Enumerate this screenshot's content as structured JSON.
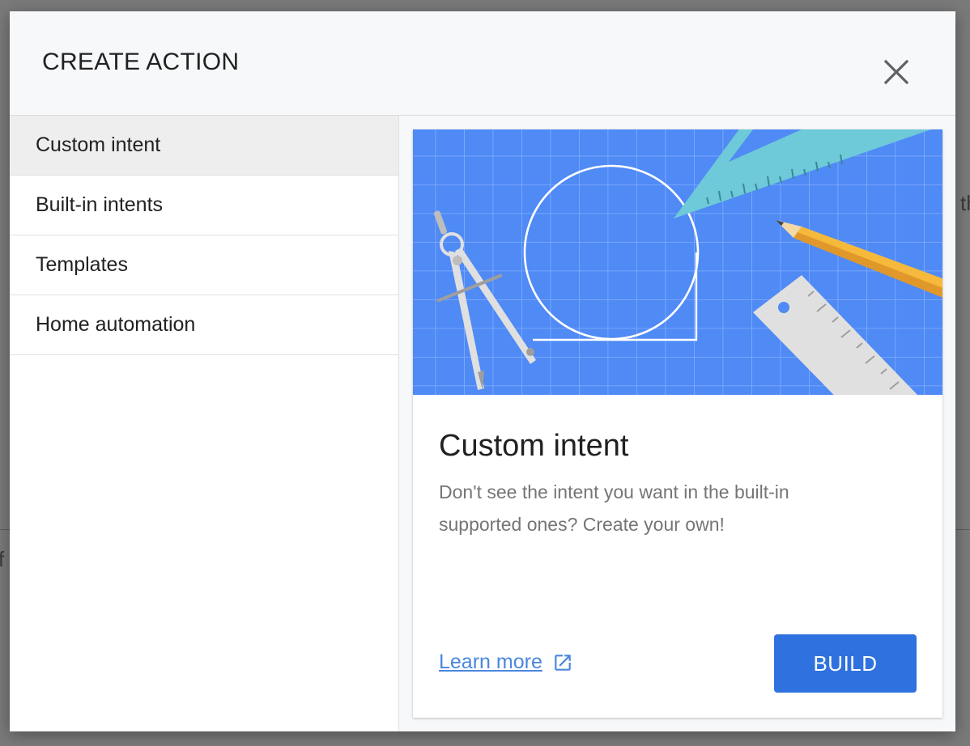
{
  "dialog": {
    "title": "CREATE ACTION",
    "close_icon": "close-icon"
  },
  "background": {
    "right_fragment": "th",
    "left_fragment": "f"
  },
  "sidebar": {
    "items": [
      {
        "label": "Custom intent",
        "selected": true
      },
      {
        "label": "Built-in intents",
        "selected": false
      },
      {
        "label": "Templates",
        "selected": false
      },
      {
        "label": "Home automation",
        "selected": false
      }
    ]
  },
  "card": {
    "illustration": "blueprint-illustration",
    "title": "Custom intent",
    "description": "Don't see the intent you want in the built-in supported ones? Create your own!",
    "learn_more_label": "Learn more",
    "learn_more_icon": "open-in-new-icon",
    "build_label": "BUILD"
  },
  "colors": {
    "accent": "#2f72df",
    "link": "#4a86e0",
    "blueprint": "#4f8af5",
    "triangle": "#6ec9d8",
    "pencil": "#f6b93b"
  }
}
